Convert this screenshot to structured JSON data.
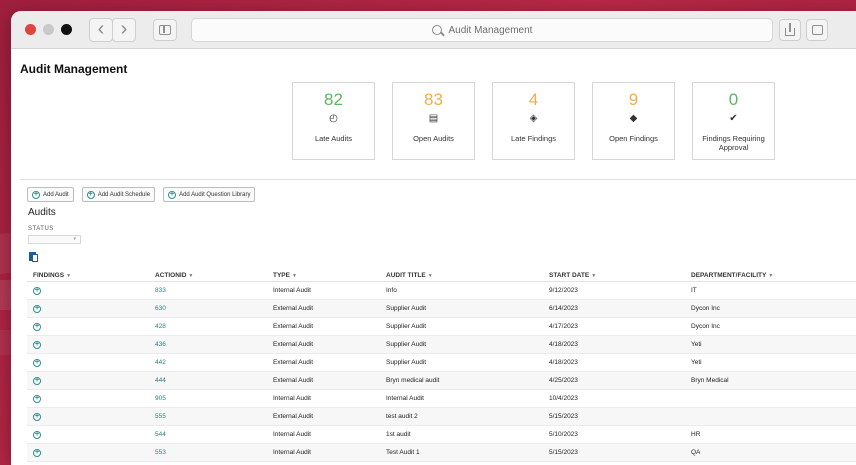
{
  "browser": {
    "address_text": "Audit Management"
  },
  "page": {
    "title": "Audit Management"
  },
  "kpis": [
    {
      "value": "82",
      "label": "Late Audits",
      "color": "#5cb85c",
      "icon": "calendar-clock-icon",
      "glyph": "◴"
    },
    {
      "value": "83",
      "label": "Open Audits",
      "color": "#f0ad4e",
      "icon": "clipboard-icon",
      "glyph": "▤"
    },
    {
      "value": "4",
      "label": "Late Findings",
      "color": "#f0ad4e",
      "icon": "findings-clock-icon",
      "glyph": "◈"
    },
    {
      "value": "9",
      "label": "Open Findings",
      "color": "#f0ad4e",
      "icon": "findings-box-icon",
      "glyph": "◆"
    },
    {
      "value": "0",
      "label": "Findings Requiring Approval",
      "color": "#5cb85c",
      "icon": "findings-check-icon",
      "glyph": "✔"
    }
  ],
  "actions": {
    "add_audit": "Add Audit",
    "add_audit_schedule": "Add Audit Schedule",
    "add_audit_question_library": "Add Audit Question Library"
  },
  "audits": {
    "section_title": "Audits",
    "status_label": "STATUS",
    "status_value": "",
    "columns": [
      "FINDINGS",
      "ACTIONID",
      "TYPE",
      "AUDIT TITLE",
      "START DATE",
      "DEPARTMENT/FACILITY"
    ],
    "rows": [
      {
        "action_id": "833",
        "type": "Internal Audit",
        "title": "Info",
        "start_date": "9/12/2023",
        "department": "IT"
      },
      {
        "action_id": "630",
        "type": "External Audit",
        "title": "Supplier Audit",
        "start_date": "6/14/2023",
        "department": "Dycon Inc"
      },
      {
        "action_id": "428",
        "type": "External Audit",
        "title": "Supplier Audit",
        "start_date": "4/17/2023",
        "department": "Dycon Inc"
      },
      {
        "action_id": "436",
        "type": "External Audit",
        "title": "Supplier Audit",
        "start_date": "4/18/2023",
        "department": "Yeti"
      },
      {
        "action_id": "442",
        "type": "External Audit",
        "title": "Supplier Audit",
        "start_date": "4/18/2023",
        "department": "Yeti"
      },
      {
        "action_id": "444",
        "type": "External Audit",
        "title": "Bryn medical audit",
        "start_date": "4/25/2023",
        "department": "Bryn Medical"
      },
      {
        "action_id": "905",
        "type": "Internal Audit",
        "title": "Internal Audit",
        "start_date": "10/4/2023",
        "department": ""
      },
      {
        "action_id": "555",
        "type": "External Audit",
        "title": "test audit 2",
        "start_date": "5/15/2023",
        "department": ""
      },
      {
        "action_id": "544",
        "type": "Internal Audit",
        "title": "1st audit",
        "start_date": "5/10/2023",
        "department": "HR"
      },
      {
        "action_id": "553",
        "type": "Internal Audit",
        "title": "Test Audit 1",
        "start_date": "5/15/2023",
        "department": "QA"
      }
    ]
  }
}
